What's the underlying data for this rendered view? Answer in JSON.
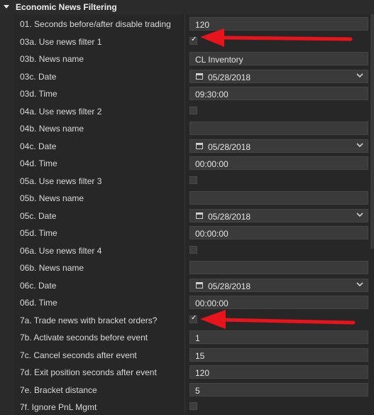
{
  "section": {
    "title": "Economic News Filtering"
  },
  "rows": [
    {
      "label": "01. Seconds before/after disable trading",
      "type": "text",
      "value": "120"
    },
    {
      "label": "03a. Use news filter 1",
      "type": "checkbox",
      "checked": true,
      "tick": "✓"
    },
    {
      "label": "03b. News name",
      "type": "text",
      "value": "CL Inventory"
    },
    {
      "label": "03c. Date",
      "type": "date",
      "value": "05/28/2018"
    },
    {
      "label": "03d. Time",
      "type": "text",
      "value": "09:30:00"
    },
    {
      "label": "04a. Use news filter 2",
      "type": "checkbox",
      "checked": false,
      "tick": ""
    },
    {
      "label": "04b. News name",
      "type": "text",
      "value": ""
    },
    {
      "label": "04c. Date",
      "type": "date",
      "value": "05/28/2018"
    },
    {
      "label": "04d. Time",
      "type": "text",
      "value": "00:00:00"
    },
    {
      "label": "05a. Use news filter 3",
      "type": "checkbox",
      "checked": false,
      "tick": ""
    },
    {
      "label": "05b. News name",
      "type": "text",
      "value": ""
    },
    {
      "label": "05c. Date",
      "type": "date",
      "value": "05/28/2018"
    },
    {
      "label": "05d. Time",
      "type": "text",
      "value": "00:00:00"
    },
    {
      "label": "06a. Use news filter 4",
      "type": "checkbox",
      "checked": false,
      "tick": ""
    },
    {
      "label": "06b. News name",
      "type": "text",
      "value": ""
    },
    {
      "label": "06c. Date",
      "type": "date",
      "value": "05/28/2018"
    },
    {
      "label": "06d. Time",
      "type": "text",
      "value": "00:00:00"
    },
    {
      "label": "7a. Trade news with bracket orders?",
      "type": "checkbox",
      "checked": true,
      "tick": "✓"
    },
    {
      "label": "7b. Activate seconds before event",
      "type": "text",
      "value": "1"
    },
    {
      "label": "7c. Cancel seconds after event",
      "type": "text",
      "value": "15"
    },
    {
      "label": "7d. Exit position seconds after event",
      "type": "text",
      "value": "120"
    },
    {
      "label": "7e. Bracket distance",
      "type": "text",
      "value": "5"
    },
    {
      "label": "7f. Ignore PnL Mgmt",
      "type": "checkbox",
      "checked": false,
      "tick": ""
    }
  ],
  "icons": {
    "collapse": "triangle-down-icon",
    "date": "calendar-icon",
    "dropdown": "chevron-down-icon",
    "check": "checkmark-icon",
    "annotation": "red-arrow-icon"
  },
  "colors": {
    "background": "#272727",
    "field": "#3a3a3a",
    "annotation_arrow": "#e8141b"
  }
}
